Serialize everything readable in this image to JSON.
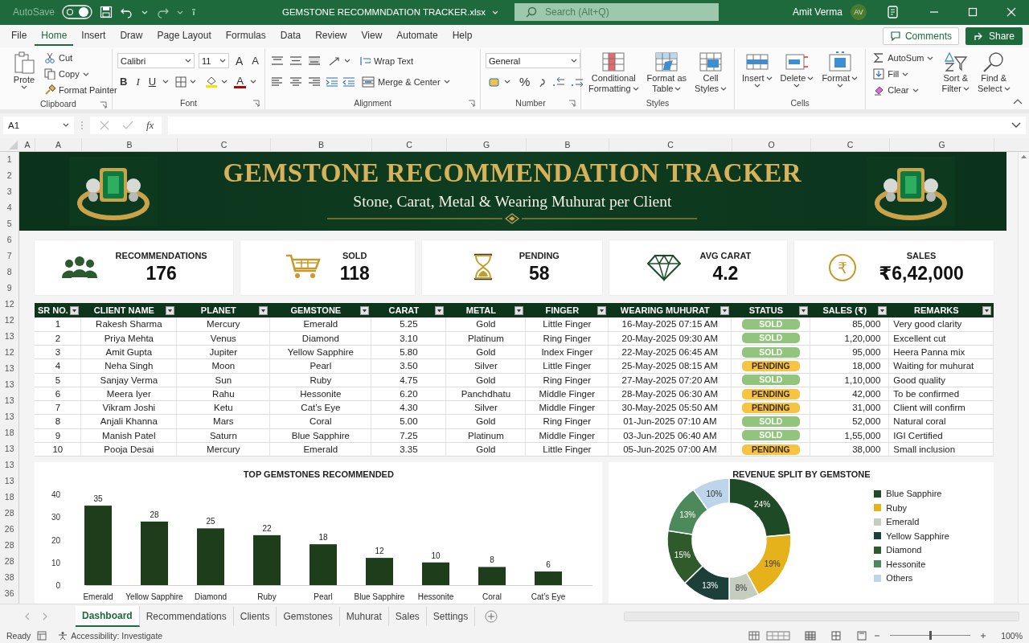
{
  "title_bar": {
    "autosave_label": "AutoSave",
    "autosave_on": true,
    "file_name": "GEMSTONE RECOMMNDATION TRACKER.xlsx",
    "search": {
      "placeholder": "Search (Alt+Q)"
    },
    "user": "Amit Verma",
    "avatar": "AV"
  },
  "menu": {
    "tabs": [
      {
        "label": "File",
        "selected": false
      },
      {
        "label": "Home",
        "selected": true
      },
      {
        "label": "Insert",
        "selected": false
      },
      {
        "label": "Draw",
        "selected": false
      },
      {
        "label": "Page Layout",
        "selected": false
      },
      {
        "label": "Formulas",
        "selected": false
      },
      {
        "label": "Data",
        "selected": false
      },
      {
        "label": "Review",
        "selected": false
      },
      {
        "label": "View",
        "selected": false
      },
      {
        "label": "Automate",
        "selected": false
      },
      {
        "label": "Help",
        "selected": false
      }
    ],
    "comments": "Comments",
    "share": "Share"
  },
  "ribbon": {
    "groups": [
      {
        "kind": "clipboard",
        "label": "Clipboard",
        "paste": "Prote",
        "small": [
          "Cut",
          "Copy",
          "Format Painter"
        ]
      },
      {
        "kind": "font",
        "label": "Font",
        "font": "Calibri",
        "size": "11",
        "grow": "A",
        "shrink": "A",
        "styles": [
          "B",
          "I",
          "U"
        ],
        "color_letter": "A"
      },
      {
        "kind": "alignment",
        "label": "Alignment",
        "wrap": "Wrap Text",
        "merge": "Merge & Center"
      },
      {
        "kind": "number",
        "label": "Number",
        "format": "General",
        "percent": "%"
      },
      {
        "kind": "big_buttons",
        "label": "Styles",
        "buttons": [
          {
            "lines": [
              "Conditional",
              "Formatting"
            ]
          },
          {
            "lines": [
              "Format as",
              "Table"
            ]
          },
          {
            "lines": [
              "Cell",
              "Styles"
            ]
          }
        ]
      },
      {
        "kind": "big_buttons",
        "label": "Cells",
        "buttons": [
          {
            "lines": [
              "Insert"
            ]
          },
          {
            "lines": [
              "Delete"
            ]
          },
          {
            "lines": [
              "Format"
            ]
          }
        ]
      },
      {
        "kind": "editing",
        "small": [
          "AutoSum",
          "Fill",
          "Clear"
        ],
        "buttons": [
          {
            "lines": [
              "Sort &",
              "Filter"
            ]
          },
          {
            "lines": [
              "Find &",
              "Select"
            ]
          }
        ]
      }
    ]
  },
  "formula_bar": {
    "name_box": "A1",
    "function_label": "fx"
  },
  "column_headers": [
    "A",
    "A",
    "B",
    "C",
    "B",
    "C",
    "G",
    "B",
    "C",
    "O",
    "C",
    "G"
  ],
  "row_headers": [
    "1",
    "2",
    "3",
    "4",
    "5",
    "6",
    "7",
    "8",
    "9",
    "12",
    "12",
    "13",
    "12",
    "13",
    "13",
    "13",
    "13",
    "18",
    "13",
    "13",
    "13",
    "18",
    "28",
    "26",
    "28",
    "28",
    "38",
    "36"
  ],
  "banner": {
    "title": "GEMSTONE RECOMMENDATION TRACKER",
    "subtitle": "Stone, Carat, Metal & Wearing Muhurat per Client"
  },
  "kpis": [
    {
      "kind": "people",
      "label": "RECOMMENDATIONS",
      "value": "176"
    },
    {
      "kind": "cart",
      "label": "SOLD",
      "value": "118"
    },
    {
      "kind": "hourglass",
      "label": "PENDING",
      "value": "58"
    },
    {
      "kind": "diamond",
      "label": "AVG CARAT",
      "value": "4.2"
    },
    {
      "kind": "coin",
      "label": "SALES",
      "value": "₹6,42,000",
      "symbol": "₹"
    }
  ],
  "table": {
    "columns": [
      "SR NO.",
      "CLIENT NAME",
      "PLANET",
      "GEMSTONE",
      "CARAT",
      "METAL",
      "FINGER",
      "WEARING MUHURAT",
      "STATUS",
      "SALES (₹)",
      "REMARKS"
    ],
    "rows": [
      {
        "cells": [
          "1",
          "Rakesh Sharma",
          "Mercury",
          "Emerald",
          "5.25",
          "Gold",
          "Little Finger",
          "16-May-2025 07:15 AM"
        ],
        "status": {
          "label": "SOLD",
          "color": "#93c47d"
        },
        "sales": "85,000",
        "remarks": "Very good clarity"
      },
      {
        "cells": [
          "2",
          "Priya Mehta",
          "Venus",
          "Diamond",
          "3.10",
          "Platinum",
          "Ring Finger",
          "20-May-2025 09:30 AM"
        ],
        "status": {
          "label": "SOLD",
          "color": "#93c47d"
        },
        "sales": "1,20,000",
        "remarks": "Excellent cut"
      },
      {
        "cells": [
          "3",
          "Amit Gupta",
          "Jupiter",
          "Yellow Sapphire",
          "5.80",
          "Gold",
          "Index Finger",
          "22-May-2025 06:45 AM"
        ],
        "status": {
          "label": "SOLD",
          "color": "#93c47d"
        },
        "sales": "95,000",
        "remarks": "Heera Panna mix"
      },
      {
        "cells": [
          "4",
          "Neha Singh",
          "Moon",
          "Pearl",
          "3.50",
          "Silver",
          "Little Finger",
          "25-May-2025 08:15 AM"
        ],
        "status": {
          "label": "PENDING",
          "color": "#f6c343"
        },
        "sales": "18,000",
        "remarks": "Waiting for muhurat"
      },
      {
        "cells": [
          "5",
          "Sanjay Verma",
          "Sun",
          "Ruby",
          "4.75",
          "Gold",
          "Ring Finger",
          "27-May-2025 07:20 AM"
        ],
        "status": {
          "label": "SOLD",
          "color": "#93c47d"
        },
        "sales": "1,10,000",
        "remarks": "Good quality"
      },
      {
        "cells": [
          "6",
          "Meera Iyer",
          "Rahu",
          "Hessonite",
          "6.20",
          "Panchdhatu",
          "Middle Finger",
          "28-May-2025 06:30 AM"
        ],
        "status": {
          "label": "PENDING",
          "color": "#f6c343"
        },
        "sales": "42,000",
        "remarks": "To be confirmed"
      },
      {
        "cells": [
          "7",
          "Vikram Joshi",
          "Ketu",
          "Cat’s Eye",
          "4.30",
          "Silver",
          "Middle Finger",
          "30-May-2025 05:50 AM"
        ],
        "status": {
          "label": "PENDING",
          "color": "#f6c343"
        },
        "sales": "31,000",
        "remarks": "Client will confirm"
      },
      {
        "cells": [
          "8",
          "Anjali Khanna",
          "Mars",
          "Coral",
          "5.00",
          "Gold",
          "Ring Finger",
          "01-Jun-2025 07:10 AM"
        ],
        "status": {
          "label": "SOLD",
          "color": "#93c47d"
        },
        "sales": "52,000",
        "remarks": "Natural coral"
      },
      {
        "cells": [
          "9",
          "Manish Patel",
          "Saturn",
          "Blue Sapphire",
          "7.25",
          "Platinum",
          "Middle Finger",
          "03-Jun-2025 06:40 AM"
        ],
        "status": {
          "label": "SOLD",
          "color": "#93c47d"
        },
        "sales": "1,55,000",
        "remarks": "IGI Certified"
      },
      {
        "cells": [
          "10",
          "Pooja Desai",
          "Mercury",
          "Emerald",
          "3.35",
          "Gold",
          "Little Finger",
          "05-Jun-2025 07:00 AM"
        ],
        "status": {
          "label": "PENDING",
          "color": "#f6c343"
        },
        "sales": "38,000",
        "remarks": "Small inclusion"
      }
    ]
  },
  "bar_chart": {
    "chart_data": {
      "type": "bar",
      "title": "TOP GEMSTONES RECOMMENDED",
      "categories": [
        "Emerald",
        "Yellow Sapphire",
        "Diamond",
        "Ruby",
        "Pearl",
        "Blue Sapphire",
        "Hessonite",
        "Coral",
        "Cat’s Eye"
      ],
      "series": [
        {
          "color": "#1d3d1b",
          "values": [
            35,
            28,
            25,
            22,
            18,
            12,
            10,
            8,
            6
          ]
        }
      ],
      "ylim": [
        0,
        40
      ],
      "yticks": [
        0,
        10,
        20,
        30,
        40
      ],
      "data_labels": true
    }
  },
  "donut_chart": {
    "chart_data": {
      "type": "donut",
      "title": "REVENUE SPLIT BY GEMSTONE",
      "categories": [
        "Blue Sapphire",
        "Ruby",
        "Emerald",
        "Yellow Sapphire",
        "Diamond",
        "Hessonite",
        "Others"
      ],
      "series": [
        {
          "colors": [
            "#1e4a26",
            "#e5b21c",
            "#c4cdc0",
            "#1d3f3a",
            "#2f5b2c",
            "#4d8a5b",
            "#bdd5eb"
          ],
          "values": [
            24,
            19,
            8,
            13,
            15,
            13,
            10
          ]
        }
      ],
      "value_labels": [
        "24%",
        "19%",
        "8%",
        "13%",
        "15%",
        "13%",
        "10%"
      ]
    }
  },
  "sheet_tabs": [
    {
      "label": "Dashboard",
      "selected": true
    },
    {
      "label": "Recommendations",
      "selected": false
    },
    {
      "label": "Clients",
      "selected": false
    },
    {
      "label": "Gemstones",
      "selected": false
    },
    {
      "label": "Muhurat",
      "selected": false
    },
    {
      "label": "Sales",
      "selected": false
    },
    {
      "label": "Settings",
      "selected": false
    }
  ],
  "status_bar": {
    "ready": "Ready",
    "accessibility": "Accessibility: Investigate",
    "zoom": {
      "label": "100%",
      "level": 0.5
    }
  }
}
